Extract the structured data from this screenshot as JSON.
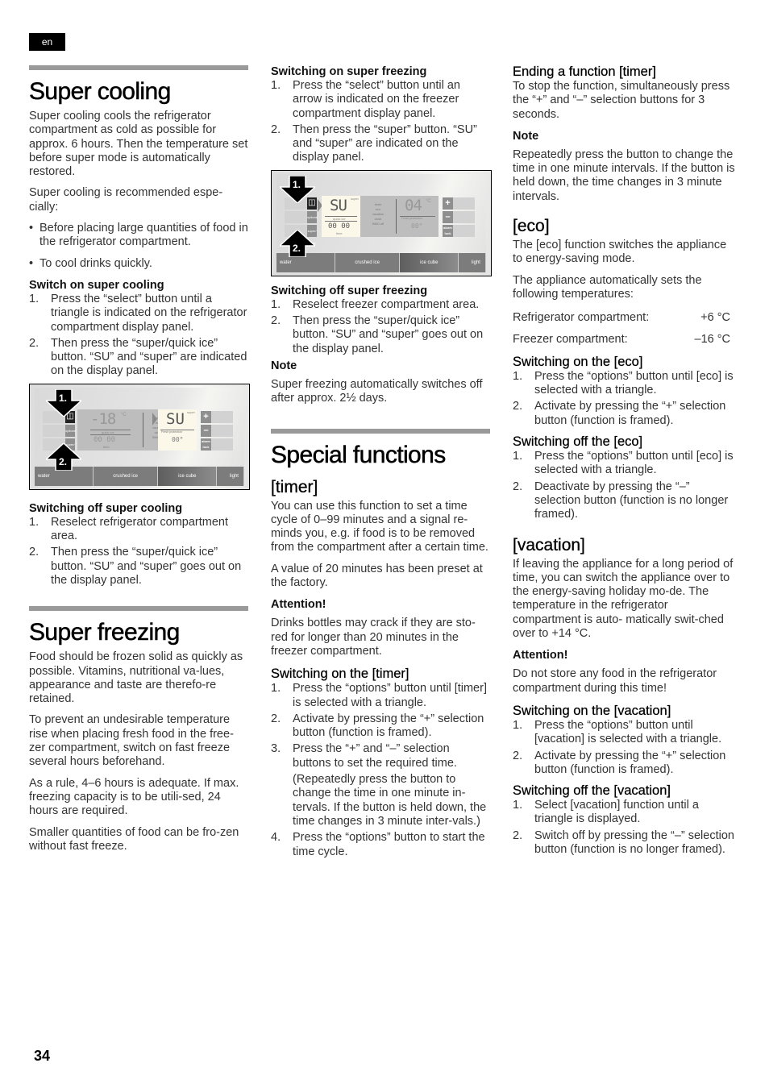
{
  "language_tag": "en",
  "page_number": "34",
  "super_cooling": {
    "title": "Super cooling",
    "intro": "Super cooling cools the refrigerator compartment as cold as possible for approx. 6 hours. Then the temperature set before super mode is automatically restored.",
    "recommended": "Super cooling is recommended espe-cially:",
    "bullets": [
      "Before placing large quantities of food in the refrigerator compartment.",
      "To cool drinks quickly."
    ],
    "switch_on_heading": "Switch on super cooling",
    "switch_on_steps": [
      "Press the “select” button until a triangle is indicated on the refrigerator compartment display panel.",
      "Then press the “super/quick ice” button. “SU” and “super” are indicated on the display panel."
    ],
    "switch_off_heading": "Switching off super cooling",
    "switch_off_steps": [
      "Reselect refrigerator compartment area.",
      "Then press the “super/quick ice” button. “SU” and “super” goes out on the display panel."
    ]
  },
  "figure_cooling": {
    "arrow1": "1.",
    "arrow2": "2.",
    "left_buttons": [
      "",
      "options",
      "super/ quick ice"
    ],
    "right_buttons": [
      "+",
      "–",
      "alarm lock"
    ],
    "freezer_temp": "-18",
    "freezer_unit": "°C",
    "freezer_label": "quick ice",
    "time_value": "00 00",
    "time_label": "time",
    "options_list": [
      "timer",
      "eco",
      "vacation",
      "clock",
      "BMO off"
    ],
    "fridge_value": "SU",
    "fridge_super": "super",
    "fridge_label": "Fresh protection",
    "fridge_sub": "00°",
    "bottom_buttons": [
      "water",
      "crushed ice",
      "ice cube",
      "light"
    ]
  },
  "super_freezing": {
    "title": "Super freezing",
    "paragraphs": [
      "Food should be frozen solid as quickly as possible. Vitamins, nutritional va-lues, appearance and taste are therefo-re retained.",
      "To prevent an undesirable temperature rise when placing fresh food in the free-zer compartment, switch on fast freeze several hours beforehand.",
      "As a rule, 4–6 hours is adequate. If max. freezing capacity is to be utili-sed, 24 hours are required.",
      "Smaller quantities of food  can be fro-zen without fast freeze."
    ],
    "switch_on_heading": "Switching on super freezing",
    "switch_on_steps": [
      "Press the “select” button until an arrow is indicated on the freezer compartment display panel.",
      "Then press the “super” button. “SU” and “super” are indicated on the display panel."
    ],
    "switch_off_heading": "Switching off super freezing",
    "switch_off_steps": [
      "Reselect freezer compartment area.",
      "Then press the “super/quick ice” button. “SU” and “super” goes out on the display panel."
    ],
    "note_heading": "Note",
    "note_text": "Super freezing automatically switches off after approx. 2½ days."
  },
  "figure_freezing": {
    "arrow1": "1.",
    "arrow2": "2.",
    "left_buttons": [
      "",
      "options",
      "super/ quick ice"
    ],
    "right_buttons": [
      "+",
      "–",
      "alarm lock"
    ],
    "freezer_value": "SU",
    "freezer_super": "super",
    "freezer_label": "quick ice",
    "time_value": "00 00",
    "time_label": "time",
    "options_list": [
      "timer",
      "eco",
      "vacation",
      "clock",
      "BMO off"
    ],
    "fridge_temp": "04",
    "fridge_unit": "°C",
    "fridge_label": "Fresh protection",
    "fridge_sub": "00°",
    "bottom_buttons": [
      "water",
      "crushed ice",
      "ice cube",
      "light"
    ]
  },
  "special_functions": {
    "title": "Special functions",
    "timer": {
      "heading": "[timer]",
      "paragraphs": [
        "You can use this function to set a time cycle of 0–99 minutes and a signal re-minds you, e.g. if food is to be removed from the compartment after a certain time.",
        "A value of 20 minutes has been preset at the factory."
      ],
      "attention_heading": "Attention!",
      "attention_text": "Drinks bottles may crack if they are sto-red for longer than 20 minutes in the freezer compartment.",
      "switch_on_heading": "Switching on the [timer]",
      "switch_on_steps": [
        "Press the “options” button until [timer] is selected with a triangle.",
        "Activate by pressing the “+” selection button (function is framed).",
        "Press the “+” and “–” selection buttons to set the required time.",
        "Press the “options” button to start the time cycle."
      ],
      "step3_note": "(Repeatedly press the button to change the time in one minute in-tervals. If the button is held down, the time changes in 3 minute inter-vals.)",
      "ending_heading": "Ending a function [timer]",
      "ending_text": "To stop the function, simultaneously press the “+” and “–” selection buttons for 3 seconds.",
      "note_heading": "Note",
      "note_text": "Repeatedly press the button to change the time in one minute intervals. If the button is held down, the time changes in 3 minute intervals."
    },
    "eco": {
      "heading": "[eco]",
      "paragraphs": [
        "The [eco] function switches the appliance to energy-saving mode.",
        "The appliance automatically sets the following temperatures:"
      ],
      "temperatures": [
        {
          "label": "Refrigerator compartment:",
          "value": "+6 °C"
        },
        {
          "label": "Freezer compartment:",
          "value": "–16 °C"
        }
      ],
      "switch_on_heading": "Switching on the [eco]",
      "switch_on_steps": [
        "Press the “options” button until [eco] is selected with a triangle.",
        "Activate by pressing the “+” selection button (function is framed)."
      ],
      "switch_off_heading": "Switching off the [eco]",
      "switch_off_steps": [
        "Press the “options” button until [eco] is selected with a triangle.",
        "Deactivate by pressing the “–” selection button (function is no longer framed)."
      ]
    },
    "vacation": {
      "heading": "[vacation]",
      "paragraph": "If leaving the appliance for a long period of time, you can switch the appliance over to the energy-saving holiday mo-de. The temperature in the refrigerator compartment is auto- matically swit-ched over to +14 °C.",
      "attention_heading": "Attention!",
      "attention_text": "Do not store any food in the refrigerator compartment during this time!",
      "switch_on_heading": "Switching on the [vacation]",
      "switch_on_steps": [
        "Press the “options” button until [vacation] is selected with a triangle.",
        "Activate by pressing the “+” selection button (function is framed)."
      ],
      "switch_off_heading": "Switching off the [vacation]",
      "switch_off_steps": [
        "Select [vacation] function until a triangle is displayed.",
        "Switch off by pressing the “–” selection button (function is no longer framed)."
      ]
    }
  }
}
